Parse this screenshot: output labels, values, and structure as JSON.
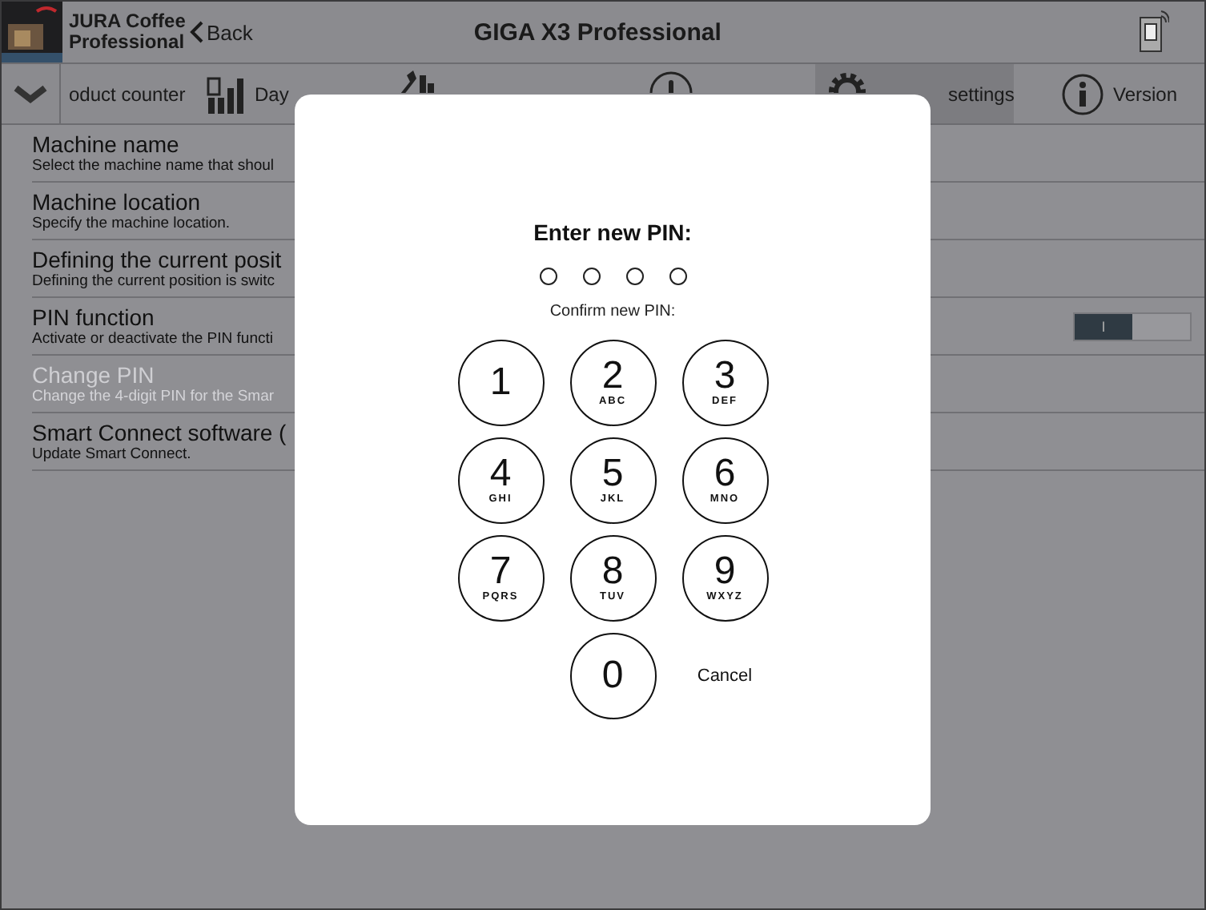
{
  "header": {
    "app_name": "JURA Coffee Professional",
    "back": "Back",
    "title": "GIGA X3 Professional"
  },
  "toolbar": {
    "tabs": [
      {
        "label": "oduct counter",
        "selected": false
      },
      {
        "label": "Day",
        "selected": false
      },
      {
        "selected": false
      },
      {
        "selected": false
      },
      {
        "label": "settings",
        "selected": true
      },
      {
        "label": "Version",
        "selected": false
      }
    ]
  },
  "settings": [
    {
      "title": "Machine name",
      "description": "Select the machine name that shoul",
      "disabled": false
    },
    {
      "title": "Machine location",
      "description": "Specify the machine location.",
      "disabled": false
    },
    {
      "title": "Defining the current posit",
      "description": "Defining the current position is switc",
      "disabled": false
    },
    {
      "title": "PIN function",
      "description": "Activate or deactivate the PIN functi",
      "disabled": false,
      "toggle": {
        "on": true,
        "label": "I"
      }
    },
    {
      "title": "Change PIN",
      "description": "Change the 4-digit PIN for the Smar",
      "disabled": true
    },
    {
      "title": "Smart Connect software (",
      "description": "Update Smart Connect.",
      "disabled": false
    }
  ],
  "pin_dialog": {
    "title": "Enter new PIN:",
    "dots": [
      {
        "filled": false
      },
      {
        "filled": false
      },
      {
        "filled": false
      },
      {
        "filled": false
      }
    ],
    "confirm_label": "Confirm new PIN:",
    "keys": [
      {
        "digit": "1"
      },
      {
        "digit": "2",
        "letters": "ABC"
      },
      {
        "digit": "3",
        "letters": "DEF"
      },
      {
        "digit": "4",
        "letters": "GHI"
      },
      {
        "digit": "5",
        "letters": "JKL"
      },
      {
        "digit": "6",
        "letters": "MNO"
      },
      {
        "digit": "7",
        "letters": "PQRS"
      },
      {
        "digit": "8",
        "letters": "TUV"
      },
      {
        "digit": "9",
        "letters": "WXYZ"
      },
      {
        "digit": "0"
      }
    ],
    "cancel": "Cancel"
  }
}
